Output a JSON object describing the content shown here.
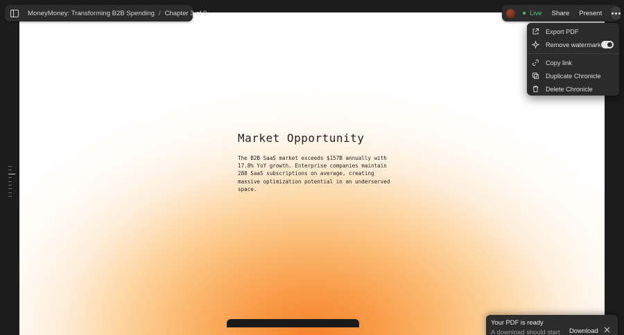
{
  "breadcrumb": {
    "document_title": "MoneyMoney: Transforming B2B Spending",
    "separator": "/",
    "chapter": "Chapter 3 of 9"
  },
  "toolbar": {
    "live_label": "Live",
    "share_label": "Share",
    "present_label": "Present",
    "live_color": "#4fc27a"
  },
  "menu": {
    "items": [
      {
        "label": "Export PDF",
        "icon": "export-icon"
      },
      {
        "label": "Remove watermark",
        "icon": "sparkle-icon",
        "toggle_on": true
      },
      {
        "label": "Copy link",
        "icon": "link-icon"
      },
      {
        "label": "Duplicate Chronicle",
        "icon": "duplicate-icon"
      },
      {
        "label": "Delete Chronicle",
        "icon": "trash-icon"
      }
    ]
  },
  "slide": {
    "title": "Market Opportunity",
    "body": "The B2B SaaS market exceeds $157B annually with 17.8% YoY growth. Enterprise companies maintain 288 SaaS subscriptions on average, creating massive optimization potential in an underserved space.",
    "gradient_color": "#f7812a"
  },
  "toast": {
    "title": "Your PDF is ready",
    "subtitle": "A download should start",
    "download_label": "Download"
  }
}
